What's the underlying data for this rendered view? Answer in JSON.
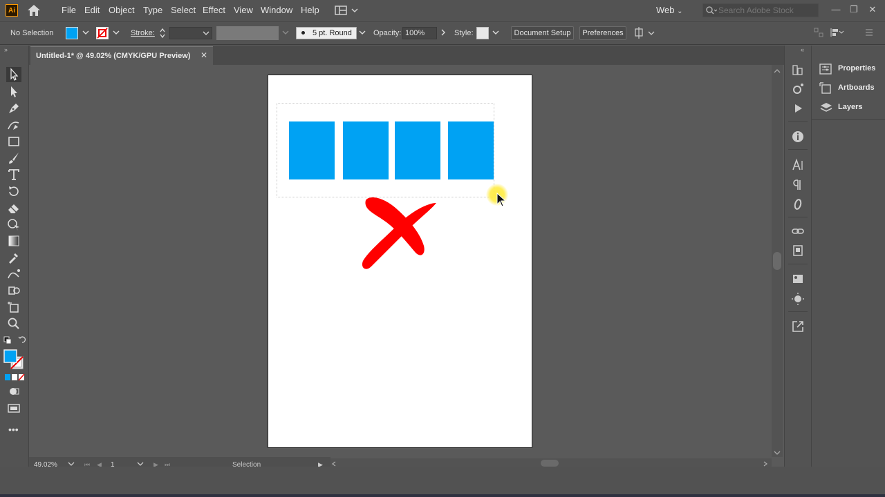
{
  "app": {
    "logo_text": "Ai",
    "menu": [
      "File",
      "Edit",
      "Object",
      "Type",
      "Select",
      "Effect",
      "View",
      "Window",
      "Help"
    ],
    "workspace": "Web",
    "search_placeholder": "Search Adobe Stock"
  },
  "control_bar": {
    "selection_label": "No Selection",
    "fill_color": "#00a2f3",
    "stroke_label": "Stroke:",
    "brush_label": "5 pt. Round",
    "opacity_label": "Opacity:",
    "opacity_value": "100%",
    "style_label": "Style:",
    "document_setup": "Document Setup",
    "preferences": "Preferences"
  },
  "document": {
    "tab_title": "Untitled-1* @ 49.02% (CMYK/GPU Preview)",
    "close_glyph": "✕",
    "artboard_color": "#ffffff",
    "rect_color": "#00a2f3",
    "cross_color": "#ff0000",
    "rect_count": 4
  },
  "status": {
    "zoom": "49.02%",
    "artboard_number": "1",
    "current_tool": "Selection"
  },
  "panels": {
    "items": [
      {
        "label": "Properties",
        "icon": "properties-icon"
      },
      {
        "label": "Artboards",
        "icon": "artboards-icon"
      },
      {
        "label": "Layers",
        "icon": "layers-icon"
      }
    ]
  },
  "tools": [
    "selection-tool-icon",
    "direct-selection-tool-icon",
    "pen-tool-icon",
    "curvature-tool-icon",
    "rectangle-tool-icon",
    "paintbrush-tool-icon",
    "type-tool-icon",
    "rotate-tool-icon",
    "eraser-tool-icon",
    "shape-builder-tool-icon",
    "gradient-tool-icon",
    "eyedropper-tool-icon",
    "blend-tool-icon",
    "artboard-tool-icon",
    "zoom-tool-icon"
  ]
}
